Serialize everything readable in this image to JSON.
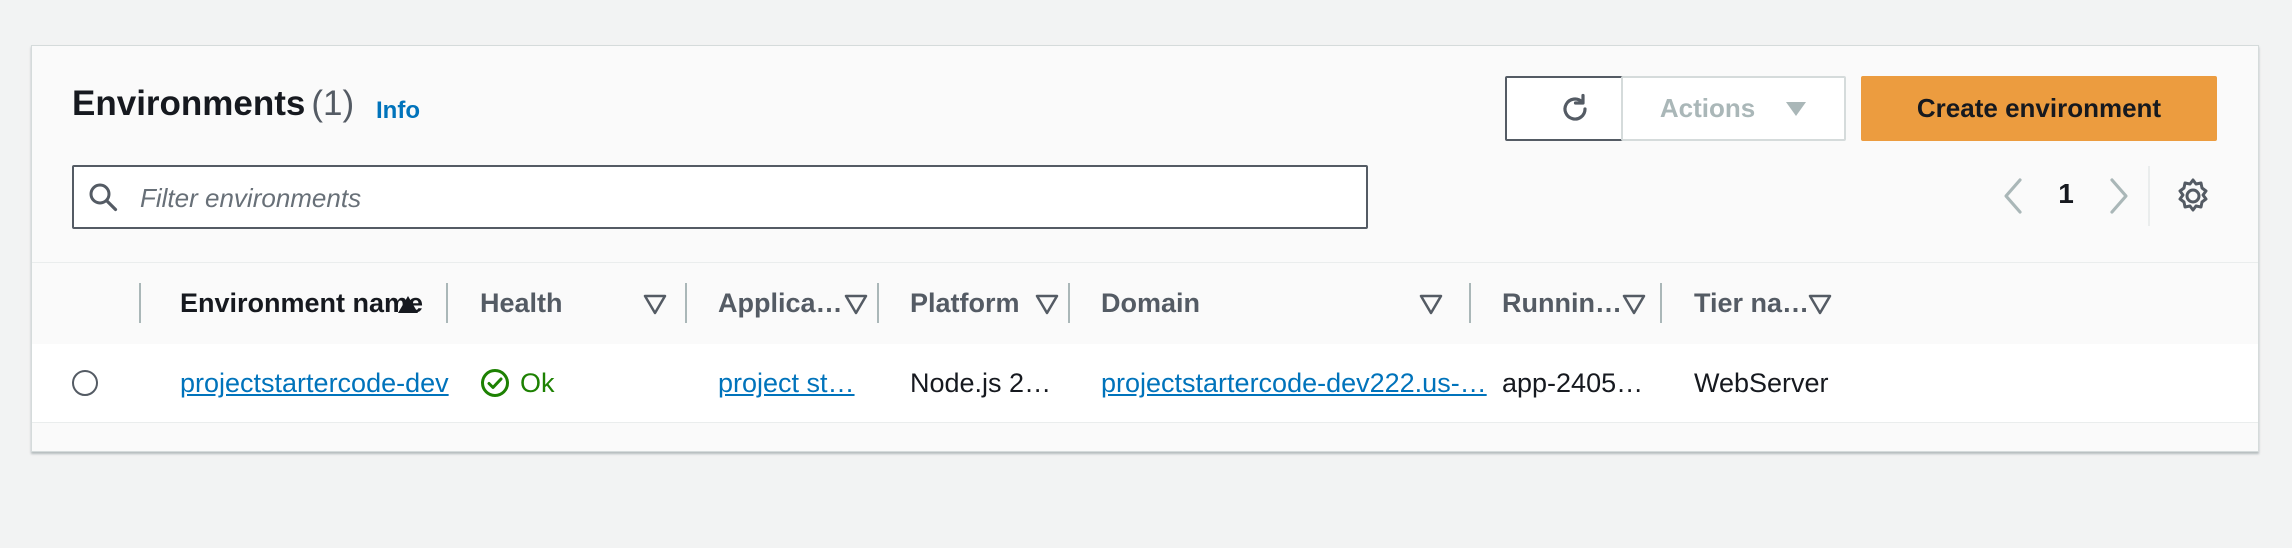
{
  "header": {
    "title": "Environments",
    "count": "(1)",
    "info_link": "Info"
  },
  "toolbar": {
    "refresh_icon": "refresh-icon",
    "actions_label": "Actions",
    "create_label": "Create environment"
  },
  "filter": {
    "placeholder": "Filter environments",
    "value": ""
  },
  "pagination": {
    "current_page": "1"
  },
  "table": {
    "columns": [
      "Environment name",
      "Health",
      "Applica…",
      "Platform",
      "Domain",
      "Runnin…",
      "Tier na…"
    ],
    "sorted_column": "Environment name",
    "rows": [
      {
        "selected": false,
        "environment_name": "projectstartercode-dev",
        "health": "Ok",
        "application": "project st…",
        "platform": "Node.js 2…",
        "domain": "projectstartercode-dev222.us-…",
        "running_version": "app-2405…",
        "tier_name": "WebServer"
      }
    ]
  },
  "colors": {
    "accent_orange": "#ec9c3f",
    "link_blue": "#0073bb",
    "health_green": "#1d8102"
  }
}
